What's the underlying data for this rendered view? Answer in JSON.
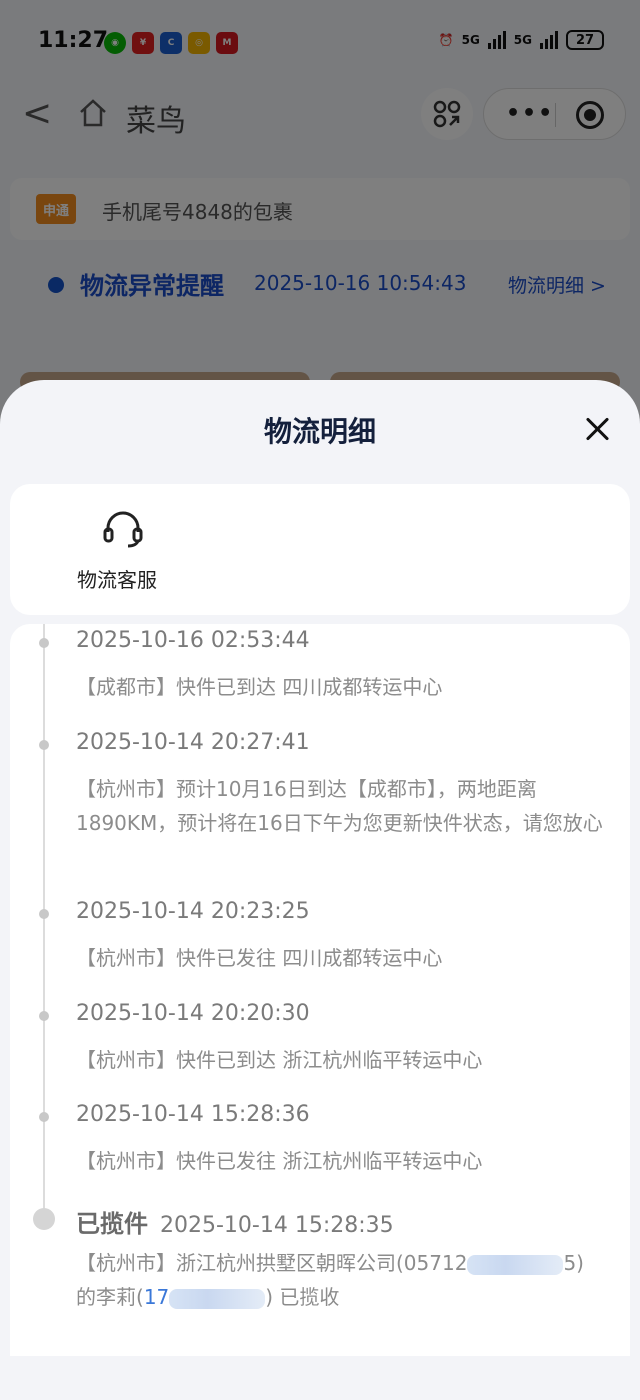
{
  "status_bar": {
    "time": "11:27",
    "network_1": "5G",
    "network_2": "5G",
    "battery": "27"
  },
  "navbar": {
    "back": "<",
    "title": "菜鸟",
    "more": "•••"
  },
  "package": {
    "courier_logo": "申通",
    "label": "手机尾号4848的包裹"
  },
  "alert": {
    "title": "物流异常提醒",
    "time": "2025-10-16 10:54:43",
    "link": "物流明细 >"
  },
  "sheet": {
    "title": "物流明细",
    "service_label": "物流客服"
  },
  "timeline": [
    {
      "time": "2025-10-16 02:53:44",
      "desc": "【成都市】快件已到达  四川成都转运中心"
    },
    {
      "time": "2025-10-14 20:27:41",
      "desc": "【杭州市】预计10月16日到达【成都市】，两地距离1890KM，预计将在16日下午为您更新快件状态，请您放心"
    },
    {
      "time": "2025-10-14 20:23:25",
      "desc": "【杭州市】快件已发往  四川成都转运中心"
    },
    {
      "time": "2025-10-14 20:20:30",
      "desc": "【杭州市】快件已到达  浙江杭州临平转运中心"
    },
    {
      "time": "2025-10-14 15:28:36",
      "desc": "【杭州市】快件已发往  浙江杭州临平转运中心"
    }
  ],
  "first_event": {
    "status": "已揽件",
    "time": "2025-10-14 15:28:35",
    "desc_prefix": "【杭州市】浙江杭州拱墅区朝晖公司(05712",
    "desc_suffix": "5)",
    "desc_line2_prefix": "的李莉(",
    "phone_prefix": "17",
    "desc_line2_suffix": ")  已揽收"
  },
  "colors": {
    "accent": "#1a4cc8",
    "courier_orange": "#f28c1e",
    "phone_link": "#3b78d8"
  }
}
